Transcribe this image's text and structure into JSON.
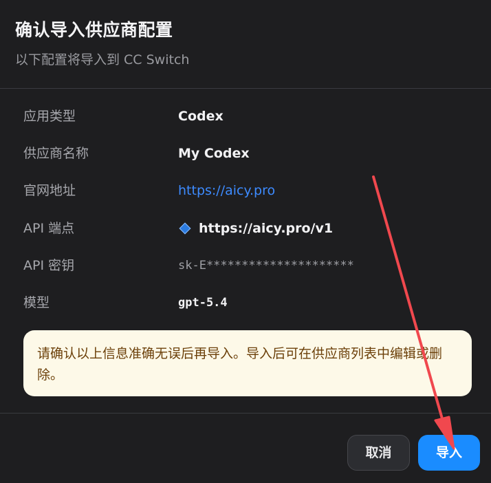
{
  "dialog": {
    "title": "确认导入供应商配置",
    "subtitle": "以下配置将导入到 CC Switch"
  },
  "fields": [
    {
      "label": "应用类型",
      "value": "Codex"
    },
    {
      "label": "供应商名称",
      "value": "My Codex"
    },
    {
      "label": "官网地址",
      "value": "https://aicy.pro"
    },
    {
      "label": "API 端点",
      "value": "https://aicy.pro/v1",
      "icon": "blue-diamond-icon"
    },
    {
      "label": "API 密钥",
      "value": "sk-E*********************"
    },
    {
      "label": "模型",
      "value": "gpt-5.4"
    }
  ],
  "notice": {
    "text": "请确认以上信息准确无误后再导入。导入后可在供应商列表中编辑或删除。"
  },
  "buttons": {
    "cancel_label": "取消",
    "confirm_label": "导入"
  },
  "colors": {
    "background": "#1e1e20",
    "link": "#3d8bff",
    "primary": "#1a8cff",
    "notice_bg": "#fdf9e8",
    "notice_text": "#6b3f08",
    "annotation_arrow": "#f0484e"
  }
}
